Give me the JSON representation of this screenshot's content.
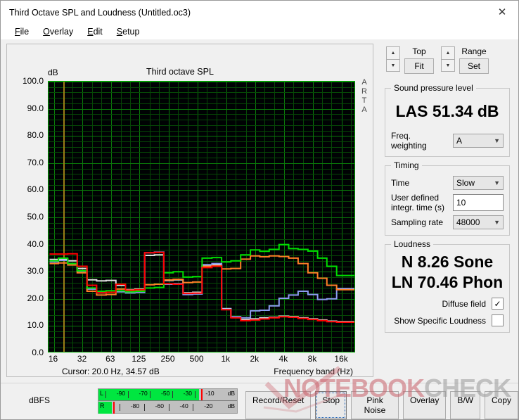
{
  "window": {
    "title": "Third Octave SPL and Loudness (Untitled.oc3)",
    "close_icon": "close-icon"
  },
  "menu": [
    {
      "label": "File",
      "accel": "F"
    },
    {
      "label": "Overlay",
      "accel": "O"
    },
    {
      "label": "Edit",
      "accel": "E"
    },
    {
      "label": "Setup",
      "accel": "S"
    }
  ],
  "chart_panel": {
    "title": "Third octave SPL",
    "y_unit": "dB",
    "watermark_side": "ARTA",
    "cursor_readout": "Cursor:   20.0 Hz, 34.57 dB",
    "x_axis_label": "Frequency band (Hz)"
  },
  "chart_data": {
    "type": "line",
    "title": "Third octave SPL",
    "xlabel": "Frequency band (Hz)",
    "ylabel": "dB",
    "ylim": [
      0.0,
      100.0
    ],
    "ytick_labels": [
      "100.0",
      "90.0",
      "80.0",
      "70.0",
      "60.0",
      "50.0",
      "40.0",
      "30.0",
      "20.0",
      "10.0",
      "0.0"
    ],
    "ytick_values": [
      100,
      90,
      80,
      70,
      60,
      50,
      40,
      30,
      20,
      10,
      0
    ],
    "xtick_labels": [
      "16",
      "32",
      "63",
      "125",
      "250",
      "500",
      "1k",
      "2k",
      "4k",
      "8k",
      "16k"
    ],
    "xtick_values": [
      16,
      32,
      63,
      125,
      250,
      500,
      1000,
      2000,
      4000,
      8000,
      16000
    ],
    "grid": true,
    "legend_position": "none",
    "plot_background": "#000204",
    "grid_color": "#0a7a0a",
    "cursor_line_color": "#9a7d16",
    "cursor_freq_hz": 20.0,
    "cursor_level_db": 34.57,
    "bands_hz": [
      16,
      20,
      25,
      31.5,
      40,
      50,
      63,
      80,
      100,
      125,
      160,
      200,
      250,
      315,
      400,
      500,
      630,
      800,
      1000,
      1250,
      1600,
      2000,
      2500,
      3150,
      4000,
      5000,
      6300,
      8000,
      10000,
      12500,
      16000,
      20000
    ],
    "series": [
      {
        "name": "red",
        "color": "#ff0000",
        "values": [
          36.5,
          36.5,
          36.6,
          32.0,
          25.0,
          22.2,
          22.4,
          25.4,
          23.2,
          23.4,
          37.0,
          37.1,
          25.6,
          25.4,
          22.0,
          22.1,
          31.5,
          32.0,
          16.0,
          13.0,
          12.0,
          12.2,
          12.6,
          13.0,
          13.4,
          13.2,
          12.8,
          12.4,
          12.0,
          11.6,
          11.4,
          11.4
        ]
      },
      {
        "name": "green",
        "color": "#00dd00",
        "values": [
          34.0,
          35.0,
          33.0,
          30.4,
          24.0,
          22.8,
          23.0,
          23.0,
          22.6,
          22.8,
          24.0,
          24.2,
          29.6,
          30.0,
          28.0,
          28.2,
          35.0,
          35.2,
          33.6,
          34.0,
          36.2,
          38.0,
          37.5,
          38.2,
          40.0,
          38.5,
          38.2,
          37.6,
          35.0,
          32.0,
          28.6,
          28.6
        ]
      },
      {
        "name": "orange",
        "color": "#ff7f27",
        "values": [
          33.0,
          33.2,
          32.5,
          29.6,
          22.8,
          21.4,
          21.6,
          23.6,
          23.0,
          23.2,
          25.2,
          25.4,
          27.0,
          27.2,
          26.0,
          26.2,
          32.0,
          32.2,
          31.0,
          31.2,
          34.6,
          35.8,
          35.5,
          35.8,
          35.6,
          35.0,
          33.0,
          29.6,
          27.6,
          25.0,
          23.4,
          23.4
        ]
      },
      {
        "name": "blue",
        "color": "#8c9cf0",
        "values": [
          33.6,
          34.2,
          33.0,
          30.2,
          23.6,
          22.2,
          22.4,
          22.6,
          22.2,
          22.4,
          37.0,
          37.2,
          25.4,
          25.6,
          21.6,
          21.8,
          32.6,
          33.0,
          16.2,
          13.4,
          13.0,
          15.6,
          15.8,
          17.4,
          20.2,
          21.4,
          22.8,
          21.6,
          19.8,
          20.0,
          23.8,
          23.8
        ]
      },
      {
        "name": "white",
        "color": "#e0e0e0",
        "values": [
          34.5,
          34.6,
          34.0,
          31.2,
          27.0,
          26.6,
          26.8,
          25.0,
          23.4,
          23.6,
          36.0,
          36.2,
          26.8,
          27.0,
          22.2,
          22.4,
          32.4,
          32.6,
          16.4,
          13.2,
          12.4,
          12.6,
          13.0,
          13.2,
          13.6,
          13.4,
          13.0,
          12.6,
          12.2,
          11.8,
          11.6,
          11.6
        ]
      }
    ]
  },
  "controls": {
    "top": {
      "label": "Top",
      "button": "Fit",
      "up_icon": "arrow-up-icon",
      "down_icon": "arrow-down-icon"
    },
    "range": {
      "label": "Range",
      "button": "Set",
      "up_icon": "arrow-up-icon",
      "down_icon": "arrow-down-icon"
    }
  },
  "spl": {
    "group_label": "Sound pressure level",
    "reading": "LAS 51.34 dB",
    "weighting_label": "Freq. weighting",
    "weighting_value": "A",
    "chevron_icon": "chevron-down-icon"
  },
  "timing": {
    "group_label": "Timing",
    "time_label": "Time",
    "time_value": "Slow",
    "integration_label_line1": "User defined",
    "integration_label_line2": "integr. time (s)",
    "integration_value": "10",
    "sampling_label": "Sampling rate",
    "sampling_value": "48000"
  },
  "loudness": {
    "group_label": "Loudness",
    "sone": "N 8.26 Sone",
    "phon": "LN 70.46 Phon",
    "diffuse_label": "Diffuse field",
    "diffuse_checked": true,
    "diffuse_mark": "✓",
    "specific_label": "Show Specific Loudness",
    "specific_checked": false,
    "specific_mark": ""
  },
  "bottom": {
    "dbfs_label": "dBFS",
    "meters": {
      "left": {
        "channel": "L",
        "unit": "dB",
        "fill_percent": 72.5,
        "peak_percent": 74.0
      },
      "right": {
        "channel": "R",
        "unit": "dB",
        "fill_percent": 9.5,
        "peak_percent": 10.5
      },
      "ticks_left": [
        "-90",
        "-70",
        "-50",
        "-30",
        "-10"
      ],
      "ticks_right": [
        "-80",
        "-60",
        "-40",
        "-20"
      ]
    },
    "buttons": [
      {
        "label": "Record/Reset",
        "focused": false
      },
      {
        "label": "Stop",
        "focused": true
      },
      {
        "label": "Pink Noise",
        "focused": false
      },
      {
        "label": "Overlay",
        "focused": false
      },
      {
        "label": "B/W",
        "focused": false
      },
      {
        "label": "Copy",
        "focused": false
      }
    ]
  },
  "watermark": {
    "part1": "NOTEBOOK",
    "part2": "CHECK",
    "check_icon": "checkmark-icon"
  }
}
